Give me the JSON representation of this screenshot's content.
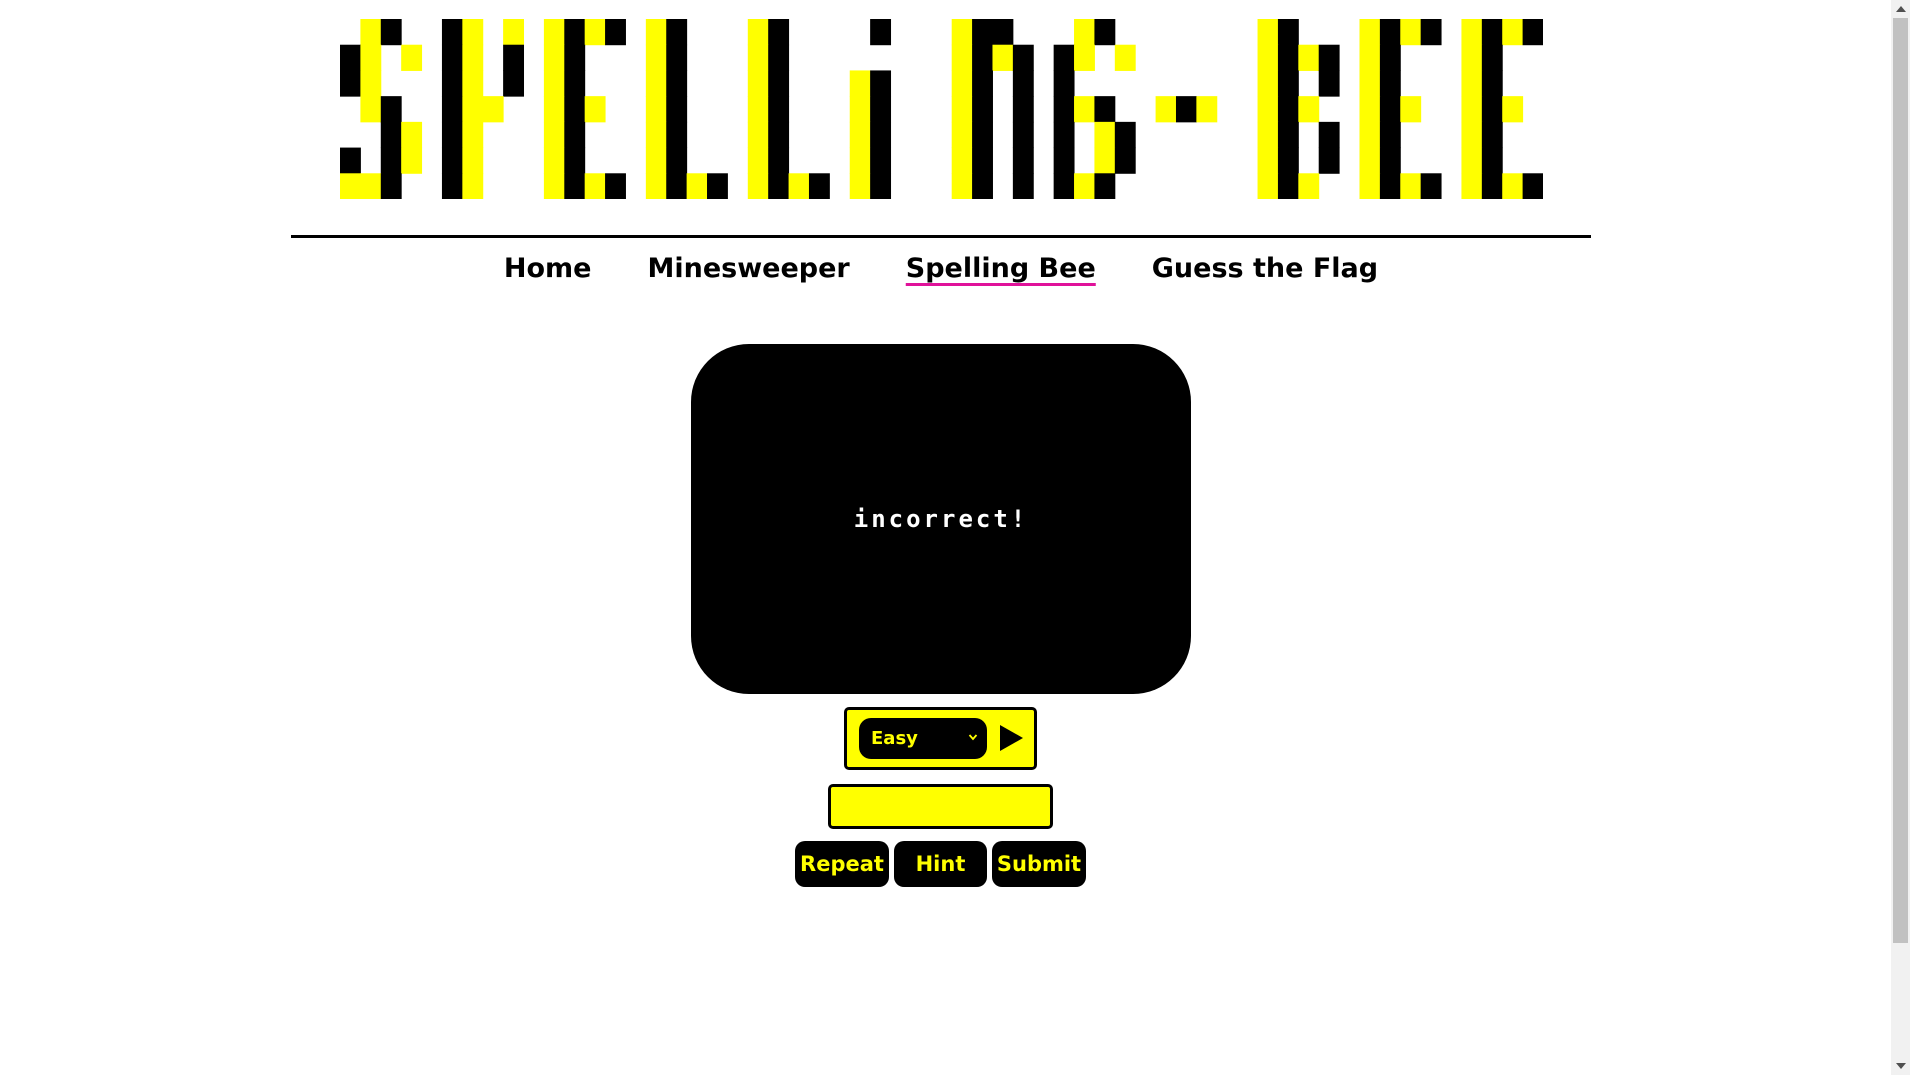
{
  "header": {
    "title": "SPELLING-BEE"
  },
  "nav": {
    "items": [
      {
        "label": "Home"
      },
      {
        "label": "Minesweeper"
      },
      {
        "label": "Spelling Bee"
      },
      {
        "label": "Guess the Flag"
      }
    ],
    "active": "Spelling Bee"
  },
  "game": {
    "message": "incorrect!",
    "difficulty": {
      "selected": "Easy"
    },
    "answer_input": {
      "value": "",
      "placeholder": ""
    },
    "buttons": {
      "repeat_label": "Repeat",
      "hint_label": "Hint",
      "submit_label": "Submit"
    },
    "play_icon": "play-icon",
    "chevron_icon": "chevron-down-icon"
  },
  "colors": {
    "accent": "#ffff00",
    "dark": "#000000",
    "active_underline": "#e0129a",
    "message_text": "#ffffff"
  }
}
